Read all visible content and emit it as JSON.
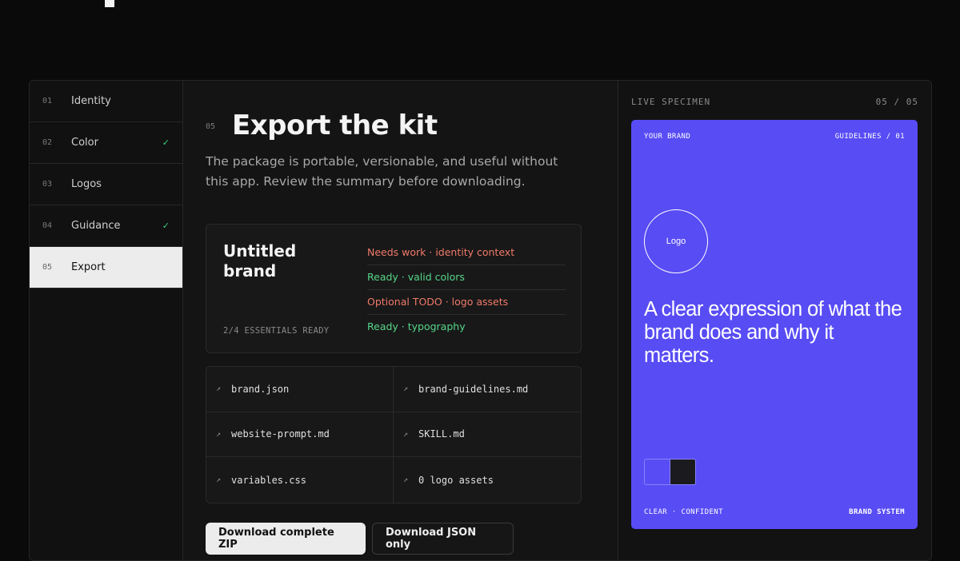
{
  "steps": [
    {
      "num": "01",
      "label": "Identity",
      "check": ""
    },
    {
      "num": "02",
      "label": "Color",
      "check": "✓"
    },
    {
      "num": "03",
      "label": "Logos",
      "check": ""
    },
    {
      "num": "04",
      "label": "Guidance",
      "check": "✓"
    },
    {
      "num": "05",
      "label": "Export",
      "check": "",
      "active": true
    }
  ],
  "header": {
    "num": "05",
    "title": "Export the kit",
    "subtitle": "The package is portable, versionable, and useful without this app. Review the summary before downloading."
  },
  "summary": {
    "brand_name": "Untitled brand",
    "essentials": "2/4 ESSENTIALS READY",
    "checks": [
      {
        "text": "Needs work · identity context",
        "status": "warn"
      },
      {
        "text": "Ready · valid colors",
        "status": "ok"
      },
      {
        "text": "Optional TODO · logo assets",
        "status": "warn"
      },
      {
        "text": "Ready · typography",
        "status": "ok"
      }
    ]
  },
  "files": [
    {
      "icon": "↗",
      "name": "brand.json"
    },
    {
      "icon": "↗",
      "name": "brand-guidelines.md"
    },
    {
      "icon": "↗",
      "name": "website-prompt.md"
    },
    {
      "icon": "↗",
      "name": "SKILL.md"
    },
    {
      "icon": "↗",
      "name": "variables.css"
    },
    {
      "icon": "↗",
      "name": "0 logo assets"
    }
  ],
  "buttons": {
    "primary": "Download complete ZIP",
    "secondary": "Download JSON only"
  },
  "preview": {
    "label": "LIVE SPECIMEN",
    "count": "05 / 05",
    "card": {
      "brand": "YOUR BRAND",
      "guidelines": "GUIDELINES / 01",
      "logo": "Logo",
      "tagline": "A clear expression of what the brand does and why it matters.",
      "swatches": [
        "#584cf4",
        "#1b1b1f"
      ],
      "footer_left": "CLEAR · CONFIDENT",
      "footer_right": "BRAND SYSTEM"
    }
  },
  "colors": {
    "accent": "#584cf4",
    "ok": "#56d688",
    "warn": "#f07a6a"
  }
}
